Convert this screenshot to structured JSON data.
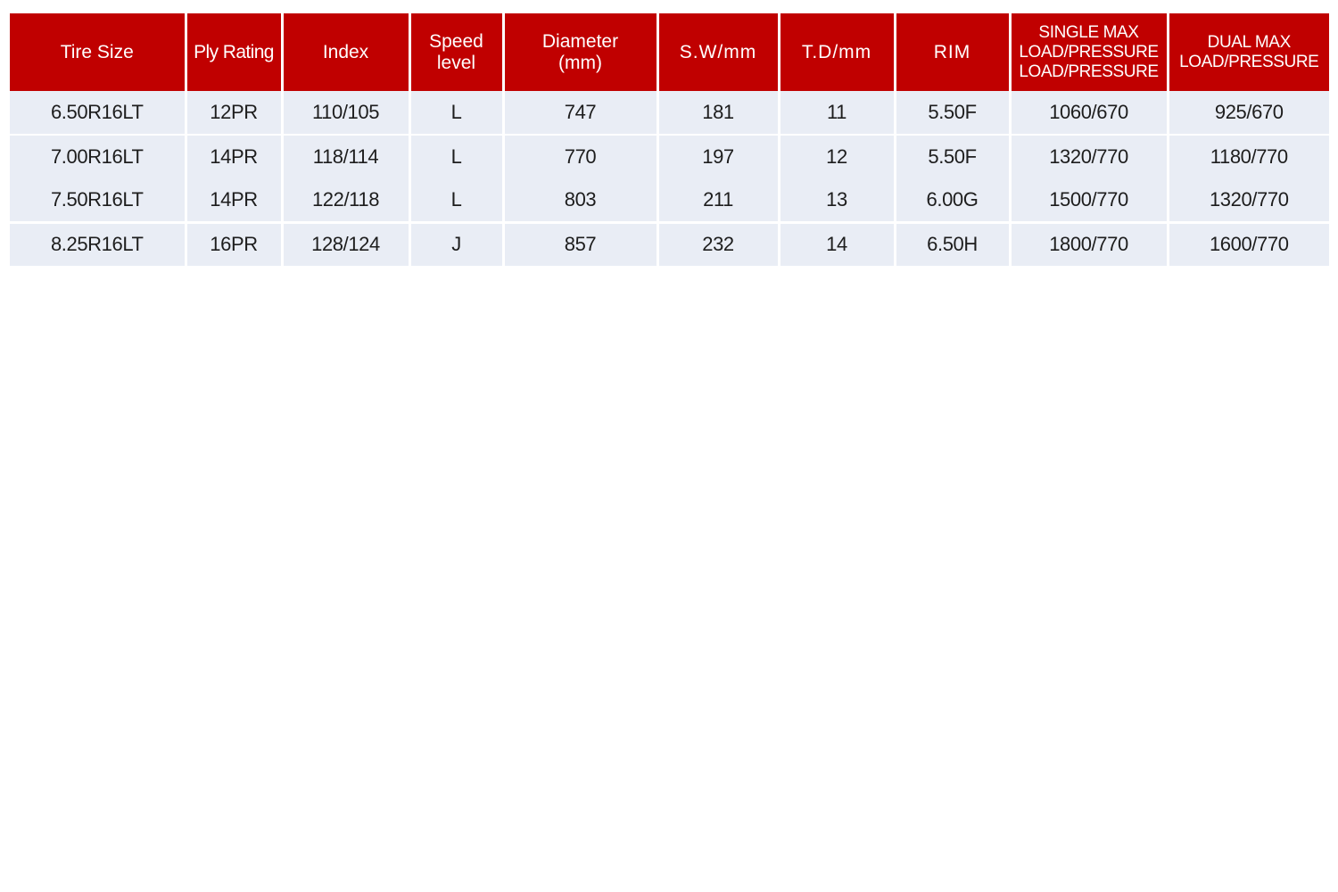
{
  "table": {
    "headers": [
      {
        "id": "tire-size",
        "lines": [
          "Tire Size"
        ]
      },
      {
        "id": "ply-rating",
        "lines": [
          "Ply Rating"
        ]
      },
      {
        "id": "index",
        "lines": [
          "Index"
        ]
      },
      {
        "id": "speed-level",
        "lines": [
          "Speed",
          "level"
        ]
      },
      {
        "id": "diameter",
        "lines": [
          "Diameter",
          "(mm)"
        ]
      },
      {
        "id": "sw-mm",
        "lines": [
          "S.W/mm"
        ]
      },
      {
        "id": "td-mm",
        "lines": [
          "T.D/mm"
        ]
      },
      {
        "id": "rim",
        "lines": [
          "RIM"
        ]
      },
      {
        "id": "single-max",
        "lines": [
          "SINGLE MAX",
          "LOAD/PRESSURE",
          "LOAD/PRESSURE"
        ]
      },
      {
        "id": "dual-max",
        "lines": [
          "DUAL MAX",
          "LOAD/PRESSURE"
        ]
      }
    ],
    "rows": [
      [
        "6.50R16LT",
        "12PR",
        "110/105",
        "L",
        "747",
        "181",
        "11",
        "5.50F",
        "1060/670",
        "925/670"
      ],
      [
        "7.00R16LT",
        "14PR",
        "118/114",
        "L",
        "770",
        "197",
        "12",
        "5.50F",
        "1320/770",
        "1180/770"
      ],
      [
        "7.50R16LT",
        "14PR",
        "122/118",
        "L",
        "803",
        "211",
        "13",
        "6.00G",
        "1500/770",
        "1320/770"
      ],
      [
        "8.25R16LT",
        "16PR",
        "128/124",
        "J",
        "857",
        "232",
        "14",
        "6.50H",
        "1800/770",
        "1600/770"
      ]
    ],
    "colors": {
      "header_bg": "#c00000",
      "header_text": "#ffffff",
      "cell_bg": "#e9edf5",
      "cell_text": "#1d1d1d"
    }
  }
}
